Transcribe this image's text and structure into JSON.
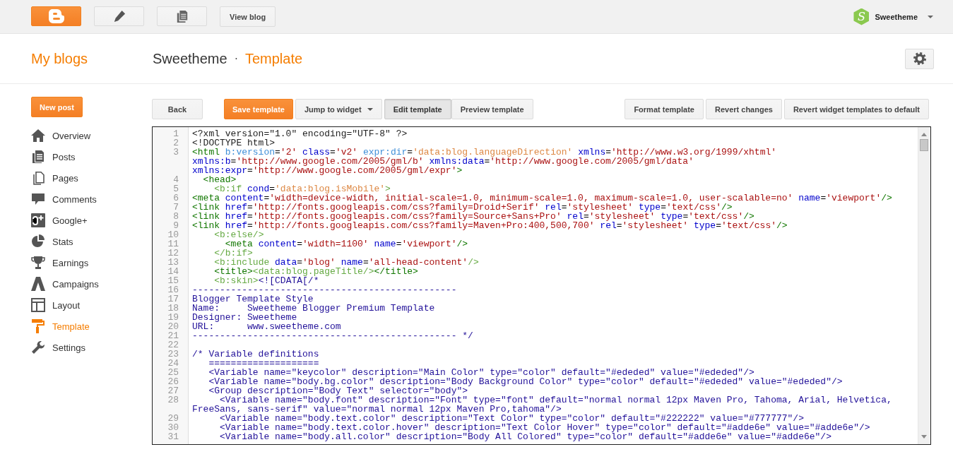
{
  "topbar": {
    "buttons": [
      {
        "kind": "logo"
      },
      {
        "kind": "pencil"
      },
      {
        "kind": "documents"
      },
      {
        "kind": "text",
        "label": "View blog"
      }
    ],
    "account": {
      "avatar_letter": "S",
      "name": "Sweetheme"
    }
  },
  "header": {
    "title": "My blogs",
    "blog": "Sweetheme",
    "separator": "·",
    "page": "Template"
  },
  "sidebar": {
    "new_post": "New post",
    "items": [
      {
        "label": "Overview",
        "kind": "home",
        "selected": false
      },
      {
        "label": "Posts",
        "kind": "posts",
        "selected": false
      },
      {
        "label": "Pages",
        "kind": "pages",
        "selected": false
      },
      {
        "label": "Comments",
        "kind": "comments",
        "selected": false
      },
      {
        "label": "Google+",
        "kind": "plus",
        "selected": false
      },
      {
        "label": "Stats",
        "kind": "stats",
        "selected": false
      },
      {
        "label": "Earnings",
        "kind": "trophy",
        "selected": false
      },
      {
        "label": "Campaigns",
        "kind": "campaigns",
        "selected": false
      },
      {
        "label": "Layout",
        "kind": "layout",
        "selected": false
      },
      {
        "label": "Template",
        "kind": "roller",
        "selected": true
      },
      {
        "label": "Settings",
        "kind": "wrench",
        "selected": false
      }
    ]
  },
  "toolbar": {
    "left": [
      {
        "label": "Back",
        "kind": "plain"
      },
      {
        "label": "Save template",
        "kind": "primary"
      },
      {
        "label": "Jump to widget",
        "kind": "dropdown"
      }
    ],
    "tabs": [
      {
        "label": "Edit template",
        "selected": true
      },
      {
        "label": "Preview template",
        "selected": false
      }
    ],
    "right": [
      {
        "label": "Format template"
      },
      {
        "label": "Revert changes"
      },
      {
        "label": "Revert widget templates to default"
      }
    ]
  },
  "editor": {
    "lines": [
      {
        "number": "1",
        "segments": [
          {
            "kind": "decl",
            "text": "<?xml version=\"1.0\" encoding=\"UTF-8\" ?>"
          }
        ]
      },
      {
        "number": "2",
        "segments": [
          {
            "kind": "decl",
            "text": "<!DOCTYPE html>"
          }
        ]
      },
      {
        "number": "3",
        "segments": [
          {
            "kind": "tag",
            "text": "<html "
          },
          {
            "kind": "battr",
            "text": "b:version"
          },
          {
            "kind": "plain",
            "text": "="
          },
          {
            "kind": "val",
            "text": "'2' "
          },
          {
            "kind": "attr",
            "text": "class"
          },
          {
            "kind": "plain",
            "text": "="
          },
          {
            "kind": "val",
            "text": "'v2' "
          },
          {
            "kind": "battr",
            "text": "expr:dir"
          },
          {
            "kind": "plain",
            "text": "="
          },
          {
            "kind": "bval",
            "text": "'data:blog.languageDirection' "
          },
          {
            "kind": "attr",
            "text": "xmlns"
          },
          {
            "kind": "plain",
            "text": "="
          },
          {
            "kind": "val",
            "text": "'http://www.w3.org/1999/xhtml' "
          },
          {
            "kind": "attr",
            "text": "xmlns:b"
          },
          {
            "kind": "plain",
            "text": "="
          },
          {
            "kind": "val",
            "text": "'http://www.google.com/2005/gml/b' "
          },
          {
            "kind": "attr",
            "text": "xmlns:data"
          },
          {
            "kind": "plain",
            "text": "="
          },
          {
            "kind": "val",
            "text": "'http://www.google.com/2005/gml/data' "
          },
          {
            "kind": "attr",
            "text": "xmlns:expr"
          },
          {
            "kind": "plain",
            "text": "="
          },
          {
            "kind": "val",
            "text": "'http://www.google.com/2005/gml/expr'"
          },
          {
            "kind": "tag",
            "text": ">"
          }
        ]
      },
      {
        "number": "4",
        "segments": [
          {
            "kind": "tag",
            "text": "  <head>"
          }
        ]
      },
      {
        "number": "5",
        "segments": [
          {
            "kind": "btag",
            "text": "    <b:if "
          },
          {
            "kind": "attr",
            "text": "cond"
          },
          {
            "kind": "plain",
            "text": "="
          },
          {
            "kind": "bval",
            "text": "'data:blog.isMobile'"
          },
          {
            "kind": "btag",
            "text": ">"
          }
        ]
      },
      {
        "number": "6",
        "segments": [
          {
            "kind": "tag",
            "text": "<meta "
          },
          {
            "kind": "attr",
            "text": "content"
          },
          {
            "kind": "plain",
            "text": "="
          },
          {
            "kind": "val",
            "text": "'width=device-width, initial-scale=1.0, minimum-scale=1.0, maximum-scale=1.0, user-scalable=no' "
          },
          {
            "kind": "attr",
            "text": "name"
          },
          {
            "kind": "plain",
            "text": "="
          },
          {
            "kind": "val",
            "text": "'viewport'"
          },
          {
            "kind": "tag",
            "text": "/>"
          }
        ]
      },
      {
        "number": "7",
        "segments": [
          {
            "kind": "tag",
            "text": "<link "
          },
          {
            "kind": "attr",
            "text": "href"
          },
          {
            "kind": "plain",
            "text": "="
          },
          {
            "kind": "val",
            "text": "'http://fonts.googleapis.com/css?family=Droid+Serif' "
          },
          {
            "kind": "attr",
            "text": "rel"
          },
          {
            "kind": "plain",
            "text": "="
          },
          {
            "kind": "val",
            "text": "'stylesheet' "
          },
          {
            "kind": "attr",
            "text": "type"
          },
          {
            "kind": "plain",
            "text": "="
          },
          {
            "kind": "val",
            "text": "'text/css'"
          },
          {
            "kind": "tag",
            "text": "/>"
          }
        ]
      },
      {
        "number": "8",
        "segments": [
          {
            "kind": "tag",
            "text": "<link "
          },
          {
            "kind": "attr",
            "text": "href"
          },
          {
            "kind": "plain",
            "text": "="
          },
          {
            "kind": "val",
            "text": "'http://fonts.googleapis.com/css?family=Source+Sans+Pro' "
          },
          {
            "kind": "attr",
            "text": "rel"
          },
          {
            "kind": "plain",
            "text": "="
          },
          {
            "kind": "val",
            "text": "'stylesheet' "
          },
          {
            "kind": "attr",
            "text": "type"
          },
          {
            "kind": "plain",
            "text": "="
          },
          {
            "kind": "val",
            "text": "'text/css'"
          },
          {
            "kind": "tag",
            "text": "/>"
          }
        ]
      },
      {
        "number": "9",
        "segments": [
          {
            "kind": "tag",
            "text": "<link "
          },
          {
            "kind": "attr",
            "text": "href"
          },
          {
            "kind": "plain",
            "text": "="
          },
          {
            "kind": "val",
            "text": "'http://fonts.googleapis.com/css?family=Maven+Pro:400,500,700' "
          },
          {
            "kind": "attr",
            "text": "rel"
          },
          {
            "kind": "plain",
            "text": "="
          },
          {
            "kind": "val",
            "text": "'stylesheet' "
          },
          {
            "kind": "attr",
            "text": "type"
          },
          {
            "kind": "plain",
            "text": "="
          },
          {
            "kind": "val",
            "text": "'text/css'"
          },
          {
            "kind": "tag",
            "text": "/>"
          }
        ]
      },
      {
        "number": "10",
        "segments": [
          {
            "kind": "btag",
            "text": "    <b:else/>"
          }
        ]
      },
      {
        "number": "11",
        "segments": [
          {
            "kind": "tag",
            "text": "      <meta "
          },
          {
            "kind": "attr",
            "text": "content"
          },
          {
            "kind": "plain",
            "text": "="
          },
          {
            "kind": "val",
            "text": "'width=1100' "
          },
          {
            "kind": "attr",
            "text": "name"
          },
          {
            "kind": "plain",
            "text": "="
          },
          {
            "kind": "val",
            "text": "'viewport'"
          },
          {
            "kind": "tag",
            "text": "/>"
          }
        ]
      },
      {
        "number": "12",
        "segments": [
          {
            "kind": "btag",
            "text": "    </b:if>"
          }
        ]
      },
      {
        "number": "13",
        "segments": [
          {
            "kind": "btag",
            "text": "    <b:include "
          },
          {
            "kind": "attr",
            "text": "data"
          },
          {
            "kind": "plain",
            "text": "="
          },
          {
            "kind": "val",
            "text": "'blog' "
          },
          {
            "kind": "attr",
            "text": "name"
          },
          {
            "kind": "plain",
            "text": "="
          },
          {
            "kind": "val",
            "text": "'all-head-content'"
          },
          {
            "kind": "btag",
            "text": "/>"
          }
        ]
      },
      {
        "number": "14",
        "segments": [
          {
            "kind": "tag",
            "text": "    <title>"
          },
          {
            "kind": "btag",
            "text": "<data:blog.pageTitle/>"
          },
          {
            "kind": "tag",
            "text": "</title>"
          }
        ]
      },
      {
        "number": "15",
        "segments": [
          {
            "kind": "btag",
            "text": "    <b:skin>"
          },
          {
            "kind": "css",
            "text": "<![CDATA[/*"
          }
        ]
      },
      {
        "number": "16",
        "segments": [
          {
            "kind": "css",
            "text": "------------------------------------------------"
          }
        ]
      },
      {
        "number": "17",
        "segments": [
          {
            "kind": "css",
            "text": "Blogger Template Style"
          }
        ]
      },
      {
        "number": "18",
        "segments": [
          {
            "kind": "css",
            "text": "Name:     Sweetheme Blogger Premium Template"
          }
        ]
      },
      {
        "number": "19",
        "segments": [
          {
            "kind": "css",
            "text": "Designer: Sweetheme"
          }
        ]
      },
      {
        "number": "20",
        "segments": [
          {
            "kind": "css",
            "text": "URL:      www.sweetheme.com"
          }
        ]
      },
      {
        "number": "21",
        "segments": [
          {
            "kind": "css",
            "text": "------------------------------------------------ */"
          }
        ]
      },
      {
        "number": "22"
      },
      {
        "number": "23",
        "segments": [
          {
            "kind": "css",
            "text": "/* Variable definitions"
          }
        ]
      },
      {
        "number": "24",
        "segments": [
          {
            "kind": "css",
            "text": "   ===================="
          }
        ]
      },
      {
        "number": "25",
        "segments": [
          {
            "kind": "css",
            "text": "   <Variable name=\"keycolor\" description=\"Main Color\" type=\"color\" default=\"#ededed\" value=\"#ededed\"/>"
          }
        ]
      },
      {
        "number": "26",
        "segments": [
          {
            "kind": "css",
            "text": "   <Variable name=\"body.bg.color\" description=\"Body Background Color\" type=\"color\" default=\"#ededed\" value=\"#ededed\"/>"
          }
        ]
      },
      {
        "number": "27",
        "segments": [
          {
            "kind": "css",
            "text": "   <Group description=\"Body Text\" selector=\"body\">"
          }
        ]
      },
      {
        "number": "28",
        "segments": [
          {
            "kind": "css",
            "text": "     <Variable name=\"body.font\" description=\"Font\" type=\"font\" default=\"normal normal 12px Maven Pro, Tahoma, Arial, Helvetica, FreeSans, sans-serif\" value=\"normal normal 12px Maven Pro,tahoma\"/>"
          }
        ]
      },
      {
        "number": "29",
        "segments": [
          {
            "kind": "css",
            "text": "     <Variable name=\"body.text.color\" description=\"Text Color\" type=\"color\" default=\"#222222\" value=\"#777777\"/>"
          }
        ]
      },
      {
        "number": "30",
        "segments": [
          {
            "kind": "css",
            "text": "     <Variable name=\"body.text.color.hover\" description=\"Text Color Hover\" type=\"color\" default=\"#adde6e\" value=\"#adde6e\"/>"
          }
        ]
      },
      {
        "number": "31",
        "segments": [
          {
            "kind": "css",
            "text": "     <Variable name=\"body.all.color\" description=\"Body All Colored\" type=\"color\" default=\"#adde6e\" value=\"#adde6e\"/>"
          }
        ]
      }
    ]
  }
}
